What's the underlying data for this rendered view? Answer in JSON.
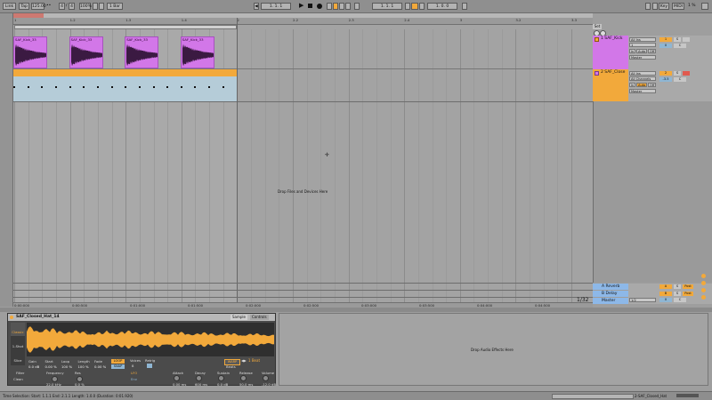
{
  "transport": {
    "link": "Link",
    "tap": "Tap",
    "tempo": "125.00",
    "sig_num": "4",
    "sig_den": "4",
    "zoom": "100%",
    "quantize": "1 Bar",
    "pos_bar": "1",
    "pos_beat": "1",
    "pos_sixteenth": "1",
    "loop_start_bar": "1",
    "loop_start_beat": "1",
    "loop_start_sixteenth": "1",
    "loop_len_bar": "1",
    "loop_len_beat": "0",
    "loop_len_sixteenth": "0",
    "key": "Key",
    "midi": "MIDI",
    "cpu": "1 %",
    "colors": {
      "accent": "#f2a93b",
      "clip": "#d277e8",
      "track2": "#f2a93b",
      "return": "#8db8e8"
    }
  },
  "ruler": {
    "bar_ticks": [
      "1",
      "1.2",
      "1.3",
      "1.4",
      "2",
      "2.2",
      "2.3",
      "2.4",
      "3",
      "3.2",
      "3.3"
    ],
    "time_ticks": [
      "0:00:000",
      "0:00:500",
      "0:01:000",
      "0:01:500",
      "0:02:000",
      "0:02:500",
      "0:03:000",
      "0:03:500",
      "0:04:000",
      "0:04:500"
    ]
  },
  "tracks": [
    {
      "name": "1 SAF_Kick",
      "input": "All Ins",
      "channel": "1",
      "monitor_in": "In",
      "monitor_auto": "Auto",
      "monitor_off": "Off",
      "output": "Master",
      "number": "1",
      "s": "S",
      "vol": "0",
      "pan": "C",
      "clips": [
        "SAF_Kick_33",
        "SAF_Kick_33",
        "SAF_Kick_33",
        "SAF_Kick_33"
      ]
    },
    {
      "name": "2 SAF_Close",
      "input": "All Ins",
      "channel": "All Channels",
      "monitor_in": "In",
      "monitor_auto": "Auto",
      "monitor_off": "Off",
      "output": "Master",
      "number": "2",
      "s": "S",
      "vol": "-3.5",
      "pan": "C"
    }
  ],
  "drop_text": "Drop Files and Devices Here",
  "returns": [
    {
      "name": "A Reverb",
      "number": "A",
      "s": "S",
      "post": "Post"
    },
    {
      "name": "B Delay",
      "number": "B",
      "s": "S",
      "post": "Post"
    },
    {
      "name": "Master",
      "output": "1/2",
      "vol": "0",
      "pan": "C"
    }
  ],
  "grid_fraction": "1/32",
  "set_label": "Set",
  "clip_view": {
    "name": "SAF_Closed_Hat_14",
    "tab_sample": "Sample",
    "tab_controls": "Controls",
    "side_btn1": "Classic",
    "side_btn2": "1-Shot",
    "side_btn3": "Slice",
    "params": [
      {
        "label": "Gain",
        "value": "0.0 dB"
      },
      {
        "label": "Start",
        "value": "0.00 %"
      },
      {
        "label": "Loop",
        "value": "100 %"
      },
      {
        "label": "Length",
        "value": "100 %"
      },
      {
        "label": "Fade",
        "value": "0.00 %"
      }
    ],
    "loop_label": "LOOP",
    "snap_label": "SNAP",
    "voices_label": "Voices",
    "voices_value": "8",
    "retrig_label": "Retrig",
    "warp_label": "WARP",
    "beats_label": "Beats",
    "beat_value": "1 Beat",
    "filter_label": "Filter",
    "filter_type": "Clean",
    "freq_label": "Frequency",
    "freq_value": "22.0 kHz",
    "res_label": "Res",
    "res_value": "0.0 %",
    "lfo_label": "LFO",
    "env_label": "Env",
    "attack_label": "Attack",
    "attack_value": "0.00 ms",
    "decay_label": "Decay",
    "decay_value": "600 ms",
    "sustain_label": "Sustain",
    "sustain_value": "0.0 dB",
    "release_label": "Release",
    "release_value": "50.0 ms",
    "volume_label": "Volume",
    "volume_value": "-12.0 dB"
  },
  "drop_audio_effects": "Drop Audio Effects Here",
  "status": {
    "text": "Time Selection:  Start: 1.1.1   End: 2.1.1   Length: 1.0.0  (Duration: 0:01.920)",
    "track_name": "2-SAF_Closed_Hat"
  }
}
